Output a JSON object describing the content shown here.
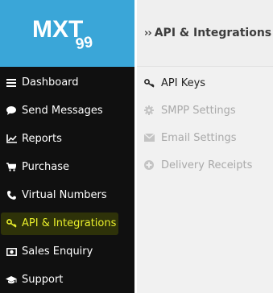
{
  "logo": {
    "text": "MXT",
    "mark": "99"
  },
  "colors": {
    "brand_blue": "#3aa6d8",
    "sidebar_bg": "#101010",
    "active_text": "#e9ef2c",
    "active_bg": "#2e3209",
    "panel_bg": "#f1f1f1"
  },
  "sidebar": {
    "items": [
      {
        "label": "Dashboard",
        "icon": "menu-icon"
      },
      {
        "label": "Send Messages",
        "icon": "chat-bubble-icon"
      },
      {
        "label": "Reports",
        "icon": "line-chart-icon"
      },
      {
        "label": "Purchase",
        "icon": "cart-icon"
      },
      {
        "label": "Virtual Numbers",
        "icon": "phone-icon"
      },
      {
        "label": "API & Integrations",
        "icon": "key-icon",
        "active": true
      },
      {
        "label": "Sales Enquiry",
        "icon": "money-icon"
      },
      {
        "label": "Support",
        "icon": "graduation-cap-icon"
      }
    ]
  },
  "panel": {
    "breadcrumb_chevron": "››",
    "title": "API & Integrations",
    "items": [
      {
        "label": "API Keys",
        "icon": "key-icon",
        "active": true
      },
      {
        "label": "SMPP Settings",
        "icon": "gear-icon"
      },
      {
        "label": "Email Settings",
        "icon": "envelope-icon"
      },
      {
        "label": "Delivery Receipts",
        "icon": "plus-circle-icon"
      }
    ]
  }
}
